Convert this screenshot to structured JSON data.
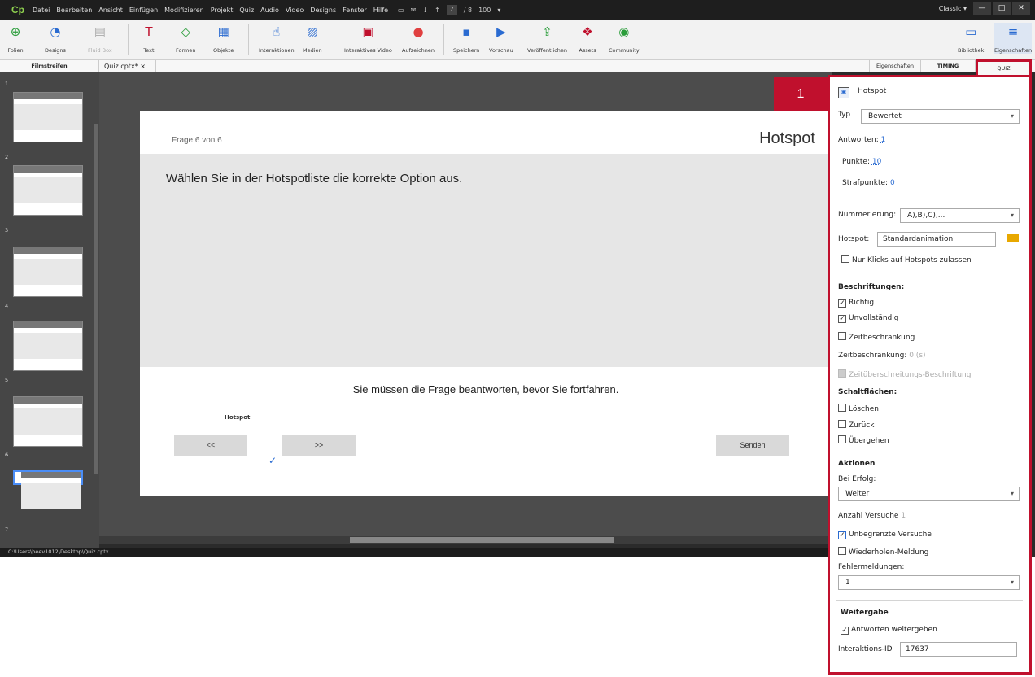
{
  "menubar": {
    "logo": "Cp",
    "items": [
      "Datei",
      "Bearbeiten",
      "Ansicht",
      "Einfügen",
      "Modifizieren",
      "Projekt",
      "Quiz",
      "Audio",
      "Video",
      "Designs",
      "Fenster",
      "Hilfe"
    ],
    "page_current": "7",
    "page_total": "/ 8",
    "zoom": "100",
    "workspace": "Classic"
  },
  "toolbar": {
    "folien": "Folien",
    "designs": "Designs",
    "fluidbox": "Fluid Box",
    "text": "Text",
    "formen": "Formen",
    "objekte": "Objekte",
    "interaktionen": "Interaktionen",
    "medien": "Medien",
    "interaktives_video": "Interaktives Video",
    "aufzeichnen": "Aufzeichnen",
    "speichern": "Speichern",
    "vorschau": "Vorschau",
    "veroeffentlichen": "Veröffentlichen",
    "assets": "Assets",
    "community": "Community",
    "bibliothek": "Bibliothek",
    "eigenschaften": "Eigenschaften"
  },
  "tabs": {
    "filmstreifen": "Filmstreifen",
    "file": "Quiz.cptx*",
    "close": "×",
    "eigenschaften": "Eigenschaften",
    "timing": "TIMING",
    "quiz": "QUIZ"
  },
  "filmstrip": {
    "numbers": [
      "1",
      "2",
      "3",
      "4",
      "5",
      "6",
      "7"
    ]
  },
  "slide": {
    "counter": "Frage 6 von 6",
    "title": "Hotspot",
    "question": "Wählen Sie in der Hotspotliste die korrekte Option aus.",
    "message": "Sie müssen die Frage beantworten, bevor Sie fortfahren.",
    "hotspot_label": "Hotspot",
    "back": "<<",
    "next": ">>",
    "submit": "Senden",
    "check": "✓"
  },
  "statusbar": "C:\\Users\\heev1012\\Desktop\\Quiz.cptx",
  "badge": "1",
  "quiz_panel": {
    "type_name": "Hotspot",
    "typ_label": "Typ",
    "typ_value": "Bewertet",
    "antworten_label": "Antworten:",
    "antworten_value": "1",
    "punkte_label": "Punkte:",
    "punkte_value": "10",
    "strafpunkte_label": "Strafpunkte:",
    "strafpunkte_value": "0",
    "nummerierung_label": "Nummerierung:",
    "nummerierung_value": "A),B),C),...",
    "hotspot_label": "Hotspot:",
    "hotspot_value": "Standardanimation",
    "nur_klicks": "Nur Klicks auf Hotspots zulassen",
    "beschriftungen": "Beschriftungen:",
    "richtig": "Richtig",
    "unvollstaendig": "Unvollständig",
    "zeitbeschraenkung_cb": "Zeitbeschränkung",
    "zeitbeschraenkung_label": "Zeitbeschränkung:",
    "zeitbeschraenkung_value": "0 (s)",
    "zeitueberschreitung": "Zeitüberschreitungs-Beschriftung",
    "schaltflaechen": "Schaltflächen:",
    "loeschen": "Löschen",
    "zurueck": "Zurück",
    "uebergehen": "Übergehen",
    "aktionen": "Aktionen",
    "bei_erfolg_label": "Bei Erfolg:",
    "bei_erfolg_value": "Weiter",
    "anzahl_versuche_label": "Anzahl Versuche",
    "anzahl_versuche_value": "1",
    "unbegrenzte": "Unbegrenzte Versuche",
    "wiederholen": "Wiederholen-Meldung",
    "fehlermeldungen_label": "Fehlermeldungen:",
    "fehlermeldungen_value": "1",
    "weitergabe": "Weitergabe",
    "antworten_weitergeben": "Antworten weitergeben",
    "interaktions_label": "Interaktions-ID",
    "interaktions_value": "17637"
  },
  "colors": {
    "accent": "#c0102d",
    "link": "#2a6bd1",
    "logo": "#8fd14f"
  }
}
